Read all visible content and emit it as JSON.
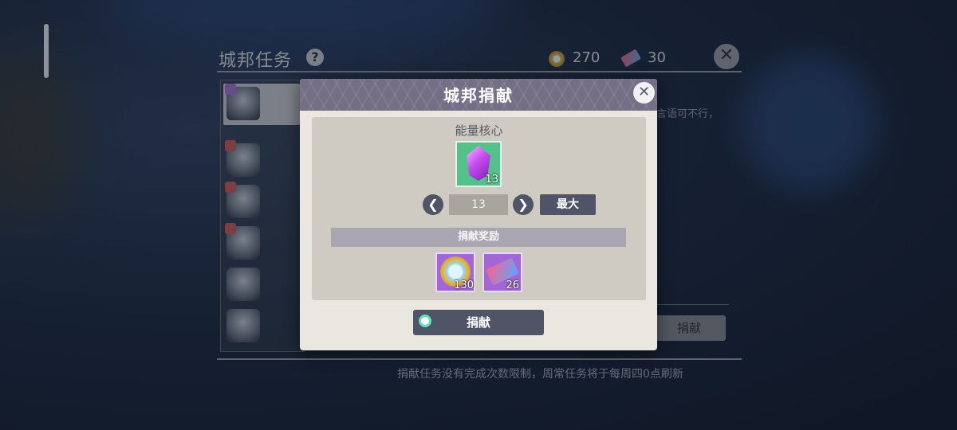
{
  "main": {
    "title": "城邦任务",
    "help_glyph": "?",
    "coin_icon": "coin-icon",
    "coin_value": "270",
    "ticket_icon": "ticket-icon",
    "ticket_value": "30",
    "close_glyph": "✕",
    "list_items": 7,
    "behind_text": "言语可不行，",
    "behind_button": "捐献",
    "footer_note": "捐献任务没有完成次数限制，周常任务将于每周四0点刷新"
  },
  "dialog": {
    "title": "城邦捐献",
    "close_glyph": "✕",
    "item_name": "能量核心",
    "item_icon": "energy-crystal-icon",
    "item_count": "13",
    "quantity": "13",
    "prev_glyph": "❮",
    "next_glyph": "❯",
    "max_label": "最大",
    "reward_header": "捐献奖励",
    "rewards": [
      {
        "icon": "coin-icon",
        "count": "130"
      },
      {
        "icon": "ticket-icon",
        "count": "26"
      }
    ],
    "donate_label": "捐献"
  },
  "colors": {
    "dialog_header": "#756f85",
    "button": "#4f5466",
    "item_box": "#54c08a",
    "reward_box": "#a366d6"
  }
}
